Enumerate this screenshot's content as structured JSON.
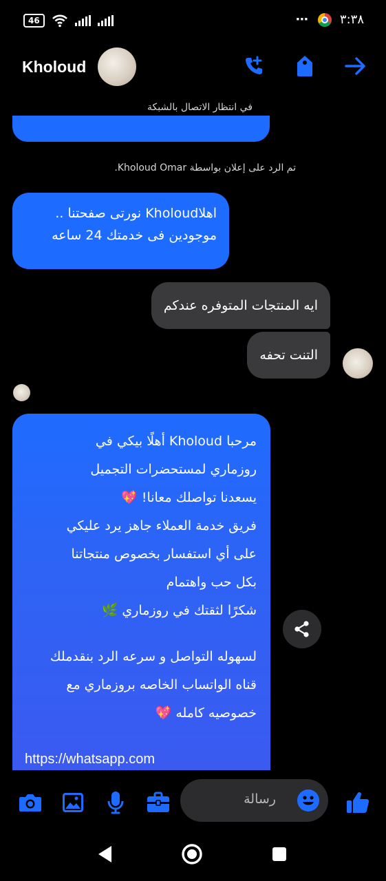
{
  "status_bar": {
    "badge": "46",
    "time": "٣:٣٨",
    "menu_dots": "⋯"
  },
  "header": {
    "contact_name": "Kholoud",
    "icons": [
      "add-call-icon",
      "tag-icon",
      "forward-arrow-icon"
    ]
  },
  "network_status": "في انتظار الاتصال بالشبكة",
  "ad_reply_note": "تم الرد على إعلان بواسطة Kholoud Omar.",
  "messages": [
    {
      "sender": "page",
      "text_lines": [
        "اهلاKholoud نورتى صفحتنا ..",
        "موجودين فى خدمتك 24 ساعه"
      ]
    },
    {
      "sender": "user",
      "text": "ايه المنتجات المتوفره عندكم"
    },
    {
      "sender": "user",
      "text": "التنت تحفه"
    },
    {
      "sender": "page",
      "text_lines": [
        "مرحبا  Kholoud  أهلًا بيكي في",
        "روزماري لمستحضرات التجميل",
        "يسعدنا تواصلك معانا! 💖",
        "فريق خدمة العملاء جاهز يرد عليكي",
        "على أي استفسار بخصوص منتجاتنا",
        "بكل حب واهتمام",
        "شكرًا لثقتك في روزماري 🌿",
        "",
        "لسهوله التواصل و سرعه الرد بنقدملك",
        "قناه الواتساب الخاصه بروزماري مع",
        "خصوصيه كامله 💖",
        ""
      ],
      "link": "https://whatsapp.com"
    }
  ],
  "composer": {
    "placeholder": "رسالة",
    "icons": [
      "camera-icon",
      "gallery-icon",
      "microphone-icon",
      "briefcase-icon",
      "emoji-icon",
      "thumbs-up-icon"
    ]
  },
  "colors": {
    "accent": "#1e6cff",
    "outgoing_bubble": "#3a3a3c",
    "background": "#000000"
  }
}
